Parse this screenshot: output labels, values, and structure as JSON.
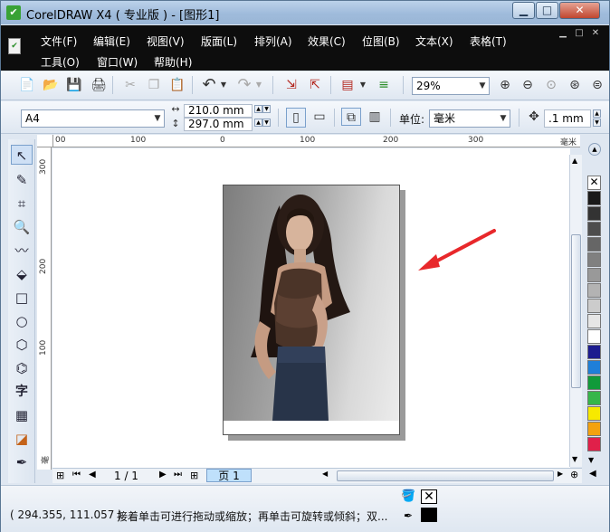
{
  "window": {
    "title": "CorelDRAW X4 ( 专业版 ) - [图形1]",
    "minimize": "▁",
    "maximize": "□",
    "close": "✕"
  },
  "menu": {
    "row1": [
      "文件(F)",
      "编辑(E)",
      "视图(V)",
      "版面(L)",
      "排列(A)",
      "效果(C)",
      "位图(B)",
      "文本(X)",
      "表格(T)"
    ],
    "row2": [
      "工具(O)",
      "窗口(W)",
      "帮助(H)"
    ],
    "mdi": [
      "▁",
      "□",
      "✕"
    ]
  },
  "standard_toolbar": {
    "zoom_value": "29%",
    "icons": [
      "new-icon",
      "open-icon",
      "save-icon",
      "print-icon",
      "cut-icon",
      "copy-icon",
      "paste-icon",
      "undo-icon",
      "redo-icon",
      "import-icon",
      "export-icon",
      "app-launcher-icon",
      "welcome-screen-icon",
      "zoom-in-icon",
      "zoom-out-icon",
      "zoom-fit-icon",
      "zoom-page-icon"
    ]
  },
  "property_bar": {
    "paper_size": "A4",
    "width": "210.0 mm",
    "height": "297.0 mm",
    "units_label": "单位:",
    "units_value": "毫米",
    "nudge_value": ".1 mm"
  },
  "ruler": {
    "h_labels": [
      "00",
      "100",
      "0",
      "100",
      "200",
      "300",
      "毫米"
    ],
    "v_labels": [
      "300",
      "200",
      "100",
      "毫"
    ]
  },
  "toolbox": {
    "text_tool": "字",
    "icons": [
      "pick-tool-icon",
      "shape-tool-icon",
      "crop-tool-icon",
      "zoom-tool-icon",
      "freehand-tool-icon",
      "smart-fill-tool-icon",
      "rectangle-tool-icon",
      "ellipse-tool-icon",
      "polygon-tool-icon",
      "basic-shapes-tool-icon",
      "text-tool-icon",
      "table-tool-icon",
      "interactive-blend-tool-icon",
      "eyedropper-tool-icon",
      "outline-tool-icon"
    ]
  },
  "page_nav": {
    "counter": "1 / 1",
    "tab_label": "页 1"
  },
  "palette": {
    "colors": [
      "#1a1a1a",
      "#333333",
      "#4d4d4d",
      "#666666",
      "#808080",
      "#999999",
      "#b3b3b3",
      "#cccccc",
      "#e6e6e6",
      "#ffffff",
      "#1c1c8f",
      "#1f7fd8",
      "#119a3a",
      "#36b64a",
      "#f7e900",
      "#f3a20f",
      "#e0204a"
    ]
  },
  "status": {
    "coordinates": "( 294.355, 111.057 )",
    "hint": "接着单击可进行拖动或缩放；再单击可旋转或倾斜；双..."
  },
  "colors": {
    "accent_arrow": "#e8282b",
    "menubar_bg": "#0d0d0d"
  }
}
